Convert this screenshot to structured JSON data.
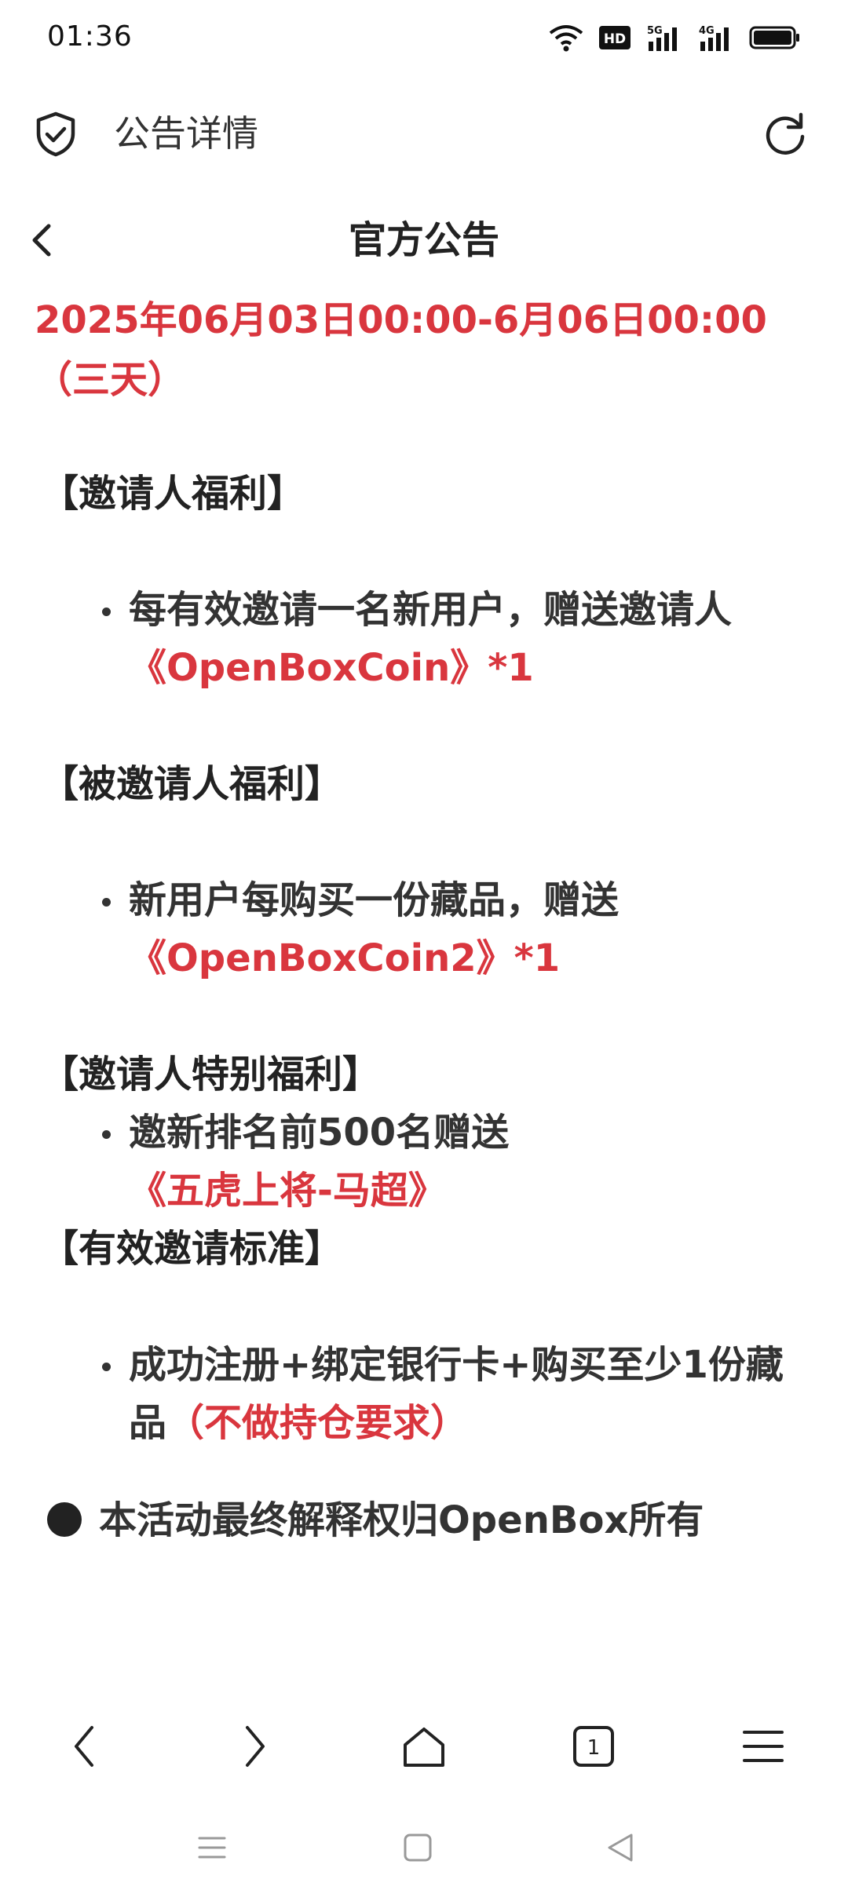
{
  "status_bar": {
    "time": "01:36",
    "hd_label": "HD",
    "network_1": "5G",
    "network_2": "4G"
  },
  "browser": {
    "title": "公告详情"
  },
  "header": {
    "title": "官方公告"
  },
  "announcement": {
    "date_line": "2025年06月03日00:00-6月06日00:00（三天）",
    "sections": [
      {
        "heading": "【邀请人福利】",
        "bullet": {
          "text": "每有效邀请一名新用户，赠送邀请人",
          "highlight": "《OpenBoxCoin》*1"
        }
      },
      {
        "heading": "【被邀请人福利】",
        "bullet": {
          "text": " 新用户每购买一份藏品，赠送",
          "highlight": "《OpenBoxCoin2》*1"
        }
      },
      {
        "heading": "【邀请人特别福利】",
        "bullet": {
          "text": "邀新排名前500名赠送",
          "highlight": "《五虎上将-马超》"
        }
      },
      {
        "heading": "【有效邀请标准】",
        "bullet": {
          "text": "成功注册+绑定银行卡+购买至少1份藏品",
          "highlight": "（不做持仓要求）"
        }
      }
    ],
    "footer_note": "本活动最终解释权归OpenBox所有"
  },
  "bottom_nav": {
    "tab_count": "1"
  },
  "colors": {
    "accent_red": "#d9363e",
    "text": "#222222"
  }
}
